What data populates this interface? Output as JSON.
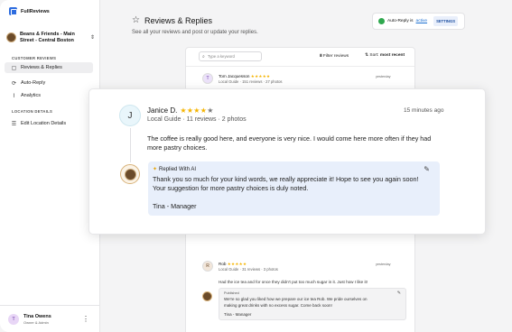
{
  "app": {
    "name": "FullReviews"
  },
  "sidebar": {
    "location": "Beans & Friends - Main Street - Central Boston",
    "chevron": "⇕",
    "sections": {
      "customer_reviews": "CUSTOMER REVIEWS",
      "location_details": "LOCATION DETAILS"
    },
    "items": [
      {
        "label": "Reviews & Replies",
        "icon": "chat-bubbles-icon"
      },
      {
        "label": "Auto-Reply",
        "icon": "gear-cycle-icon"
      },
      {
        "label": "Analytics",
        "icon": "chart-icon"
      },
      {
        "label": "Edit Location Details",
        "icon": "list-icon"
      }
    ],
    "user": {
      "initial": "T",
      "name": "Tina Owens",
      "role": "Owner & Admin"
    }
  },
  "header": {
    "title": "Reviews & Replies",
    "subtitle": "See all your reviews and post or update your replies.",
    "auto_reply": {
      "label": "Auto-Reply is",
      "status": "active",
      "button": "SETTINGS"
    }
  },
  "toolbar": {
    "search_placeholder": "Type a keyword",
    "filter": "Filter reviews",
    "sort_label": "Sort:",
    "sort_value": "most recent"
  },
  "reviews_bg": [
    {
      "initial": "T",
      "name": "Tom Jacquesson",
      "stars": "★★★★★",
      "meta": "Local Guide · 151 reviews · 27 photos",
      "time": "yesterday"
    },
    {
      "initial": "R",
      "name": "Rob",
      "stars": "★★★★★",
      "meta": "Local Guide · 31 reviews · 3 photos",
      "time": "yesterday",
      "text": "Had the ice tea and for once they didn't put too much sugar in it. Just how I like it!",
      "reply_label": "Published",
      "reply_text_1": "We're so glad you liked how we prepare our ice tea Rob. We pride ourselves on",
      "reply_text_2": "making great drinks with no excess sugar. Come back soon!",
      "reply_sign": "Tina - Manager"
    }
  ],
  "focus_review": {
    "initial": "J",
    "name": "Janice D.",
    "stars_on": "★★★★",
    "stars_off": "★",
    "meta": "Local Guide · 11 reviews · 2 photos",
    "time": "15 minutes ago",
    "text": "The coffee is really good here, and everyone is very nice. I would come here more often if they had more pastry choices.",
    "reply_label": "Replied With AI",
    "reply_text": "Thank you so much for your kind words, we really appreciate it! Hope to see you again soon! Your suggestion for more pastry choices is duly noted.",
    "reply_sign": "Tina - Manager"
  }
}
